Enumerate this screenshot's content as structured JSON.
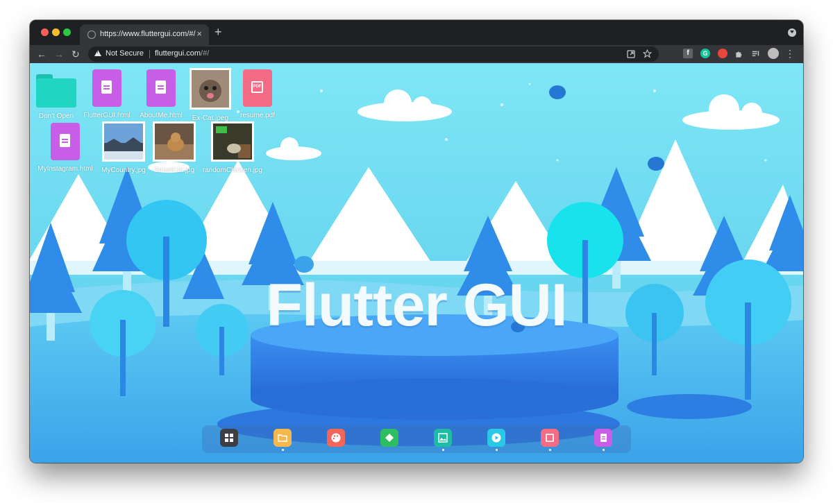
{
  "browser": {
    "tab_title": "https://www.fluttergui.com/#/",
    "tab_close": "×",
    "new_tab": "+",
    "security_label": "Not Secure",
    "url_domain": "fluttergui.com",
    "url_path": "/#/",
    "nav": {
      "back": "←",
      "forward": "→",
      "reload": "↻"
    },
    "toolbar_icons": [
      "open-in-app-icon",
      "star-icon",
      "facebook-extension-icon",
      "grammarly-extension-icon",
      "red-extension-icon",
      "puzzle-extensions-icon",
      "reading-list-icon",
      "profile-avatar",
      "kebab-menu-icon"
    ],
    "ext_f": "f",
    "ext_g": "G",
    "menu": "⋮"
  },
  "desktop": {
    "title": "Flutter GUI",
    "row1": [
      {
        "label": "Don't Open",
        "kind": "folder"
      },
      {
        "label": "FlutterGUI.html",
        "kind": "html"
      },
      {
        "label": "AboutMe.html",
        "kind": "html"
      },
      {
        "label": "Ex-Cat.jpeg",
        "kind": "image"
      },
      {
        "label": "resume.pdf",
        "kind": "pdf"
      }
    ],
    "row2": [
      {
        "label": "MyInstagram.html",
        "kind": "html"
      },
      {
        "label": "MyCountry.jpg",
        "kind": "image"
      },
      {
        "label": "StreetCat.jpg",
        "kind": "image"
      },
      {
        "label": "randomChicken.jpg",
        "kind": "image"
      }
    ],
    "pdf_badge": "PDF"
  },
  "dock": {
    "items": [
      {
        "name": "grid-apps-icon",
        "color": "#3d3f44",
        "running": false
      },
      {
        "name": "folder-icon",
        "color": "#f6b84e",
        "running": true
      },
      {
        "name": "palette-icon",
        "color": "#f2675a",
        "running": false
      },
      {
        "name": "gamepad-icon",
        "color": "#2fbd62",
        "running": false
      },
      {
        "name": "image-icon",
        "color": "#1ebba5",
        "running": true
      },
      {
        "name": "play-icon",
        "color": "#29c8e6",
        "running": true
      },
      {
        "name": "pdf-icon",
        "color": "#f46b86",
        "running": true
      },
      {
        "name": "document-icon",
        "color": "#c85ee8",
        "running": true
      }
    ]
  },
  "colors": {
    "sky": "#67d9ef",
    "accent_purple": "#c85ee8",
    "accent_pink": "#f46b86",
    "folder_teal": "#20d6c2"
  }
}
